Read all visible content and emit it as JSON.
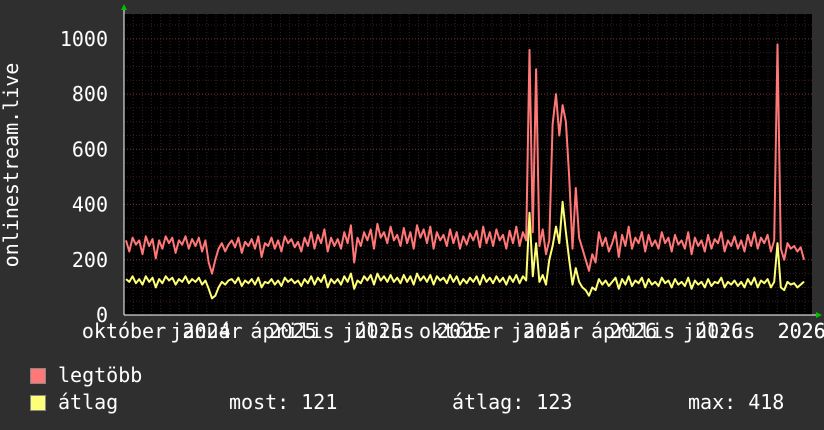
{
  "chart_data": {
    "type": "line",
    "ylabel": "onlinestream.live",
    "ylim": [
      0,
      1090
    ],
    "yticks": [
      0,
      200,
      400,
      600,
      800,
      1000
    ],
    "x_tick_labels": [
      "október",
      "január",
      "április",
      "július",
      "október",
      "január",
      "április",
      "július",
      "2024",
      "2025",
      "2025",
      "2025",
      "2025",
      "2026",
      "2026",
      "2026",
      "2026"
    ],
    "x_tick_points": [
      0.0,
      0.12,
      0.245,
      0.37,
      0.49,
      0.615,
      0.74,
      0.865,
      0.12,
      0.245,
      0.37,
      0.49,
      0.615,
      0.74,
      0.865,
      0.985,
      0.985
    ],
    "grid": true,
    "colors": {
      "background": "#2f2f2f",
      "plot": "#000000",
      "grid": "#4a2a2a",
      "axis": "#ffffff",
      "max_line": "#ff7777",
      "avg_line": "#ffff77"
    },
    "series": [
      {
        "name": "legtöbb",
        "color": "#ff7777",
        "values": [
          270,
          230,
          280,
          255,
          270,
          220,
          285,
          250,
          275,
          205,
          270,
          240,
          285,
          260,
          280,
          225,
          270,
          255,
          285,
          240,
          275,
          250,
          280,
          230,
          270,
          190,
          150,
          200,
          240,
          260,
          230,
          255,
          270,
          245,
          280,
          225,
          265,
          250,
          275,
          240,
          285,
          210,
          260,
          250,
          280,
          240,
          270,
          230,
          285,
          260,
          275,
          245,
          265,
          230,
          280,
          250,
          300,
          240,
          290,
          260,
          310,
          230,
          280,
          250,
          275,
          240,
          300,
          260,
          325,
          190,
          280,
          250,
          300,
          270,
          310,
          240,
          330,
          280,
          300,
          260,
          320,
          270,
          290,
          250,
          315,
          260,
          300,
          240,
          325,
          280,
          310,
          260,
          320,
          240,
          300,
          270,
          290,
          250,
          310,
          260,
          300,
          240,
          285,
          255,
          295,
          270,
          305,
          245,
          320,
          260,
          300,
          250,
          310,
          270,
          290,
          240,
          305,
          260,
          320,
          250,
          300,
          270,
          960,
          300,
          890,
          250,
          310,
          220,
          270,
          690,
          800,
          650,
          760,
          700,
          500,
          240,
          460,
          280,
          240,
          200,
          160,
          220,
          190,
          300,
          250,
          280,
          230,
          260,
          300,
          210,
          290,
          250,
          320,
          240,
          280,
          260,
          300,
          230,
          290,
          250,
          270,
          240,
          300,
          260,
          280,
          230,
          290,
          255,
          270,
          240,
          300,
          220,
          280,
          250,
          270,
          230,
          290,
          240,
          275,
          260,
          300,
          230,
          270,
          250,
          285,
          240,
          270,
          230,
          290,
          250,
          300,
          240,
          280,
          260,
          290,
          230,
          270,
          980,
          240,
          200,
          260,
          240,
          250,
          230,
          245,
          200
        ]
      },
      {
        "name": "átlag",
        "color": "#ffff77",
        "values": [
          130,
          120,
          140,
          115,
          130,
          110,
          140,
          120,
          135,
          100,
          130,
          115,
          140,
          125,
          135,
          110,
          130,
          120,
          140,
          115,
          130,
          120,
          135,
          110,
          125,
          95,
          60,
          70,
          100,
          120,
          110,
          125,
          130,
          115,
          135,
          105,
          125,
          115,
          130,
          110,
          135,
          100,
          120,
          115,
          130,
          110,
          125,
          105,
          135,
          120,
          130,
          115,
          125,
          105,
          130,
          115,
          140,
          110,
          135,
          120,
          145,
          100,
          130,
          115,
          130,
          110,
          140,
          120,
          150,
          95,
          125,
          115,
          140,
          125,
          145,
          110,
          150,
          125,
          140,
          120,
          145,
          120,
          135,
          115,
          145,
          120,
          140,
          110,
          150,
          125,
          140,
          120,
          145,
          110,
          140,
          125,
          135,
          115,
          145,
          120,
          140,
          110,
          130,
          115,
          135,
          120,
          140,
          110,
          145,
          120,
          135,
          115,
          140,
          120,
          135,
          110,
          140,
          120,
          145,
          115,
          140,
          125,
          370,
          140,
          260,
          120,
          145,
          110,
          200,
          250,
          320,
          260,
          410,
          300,
          200,
          110,
          170,
          120,
          100,
          90,
          70,
          100,
          90,
          130,
          110,
          125,
          105,
          120,
          135,
          95,
          130,
          110,
          140,
          105,
          125,
          115,
          135,
          100,
          130,
          110,
          120,
          105,
          135,
          115,
          125,
          100,
          130,
          110,
          120,
          105,
          135,
          95,
          125,
          110,
          120,
          100,
          130,
          105,
          120,
          115,
          135,
          100,
          120,
          110,
          125,
          105,
          120,
          100,
          130,
          110,
          135,
          100,
          125,
          115,
          130,
          100,
          120,
          260,
          100,
          90,
          120,
          110,
          115,
          100,
          110,
          121
        ]
      }
    ]
  },
  "legend": {
    "max_label": "legtöbb",
    "avg_label": "átlag"
  },
  "stats": {
    "current": "most: 121",
    "average": "átlag: 123",
    "maximum": "max: 418"
  }
}
